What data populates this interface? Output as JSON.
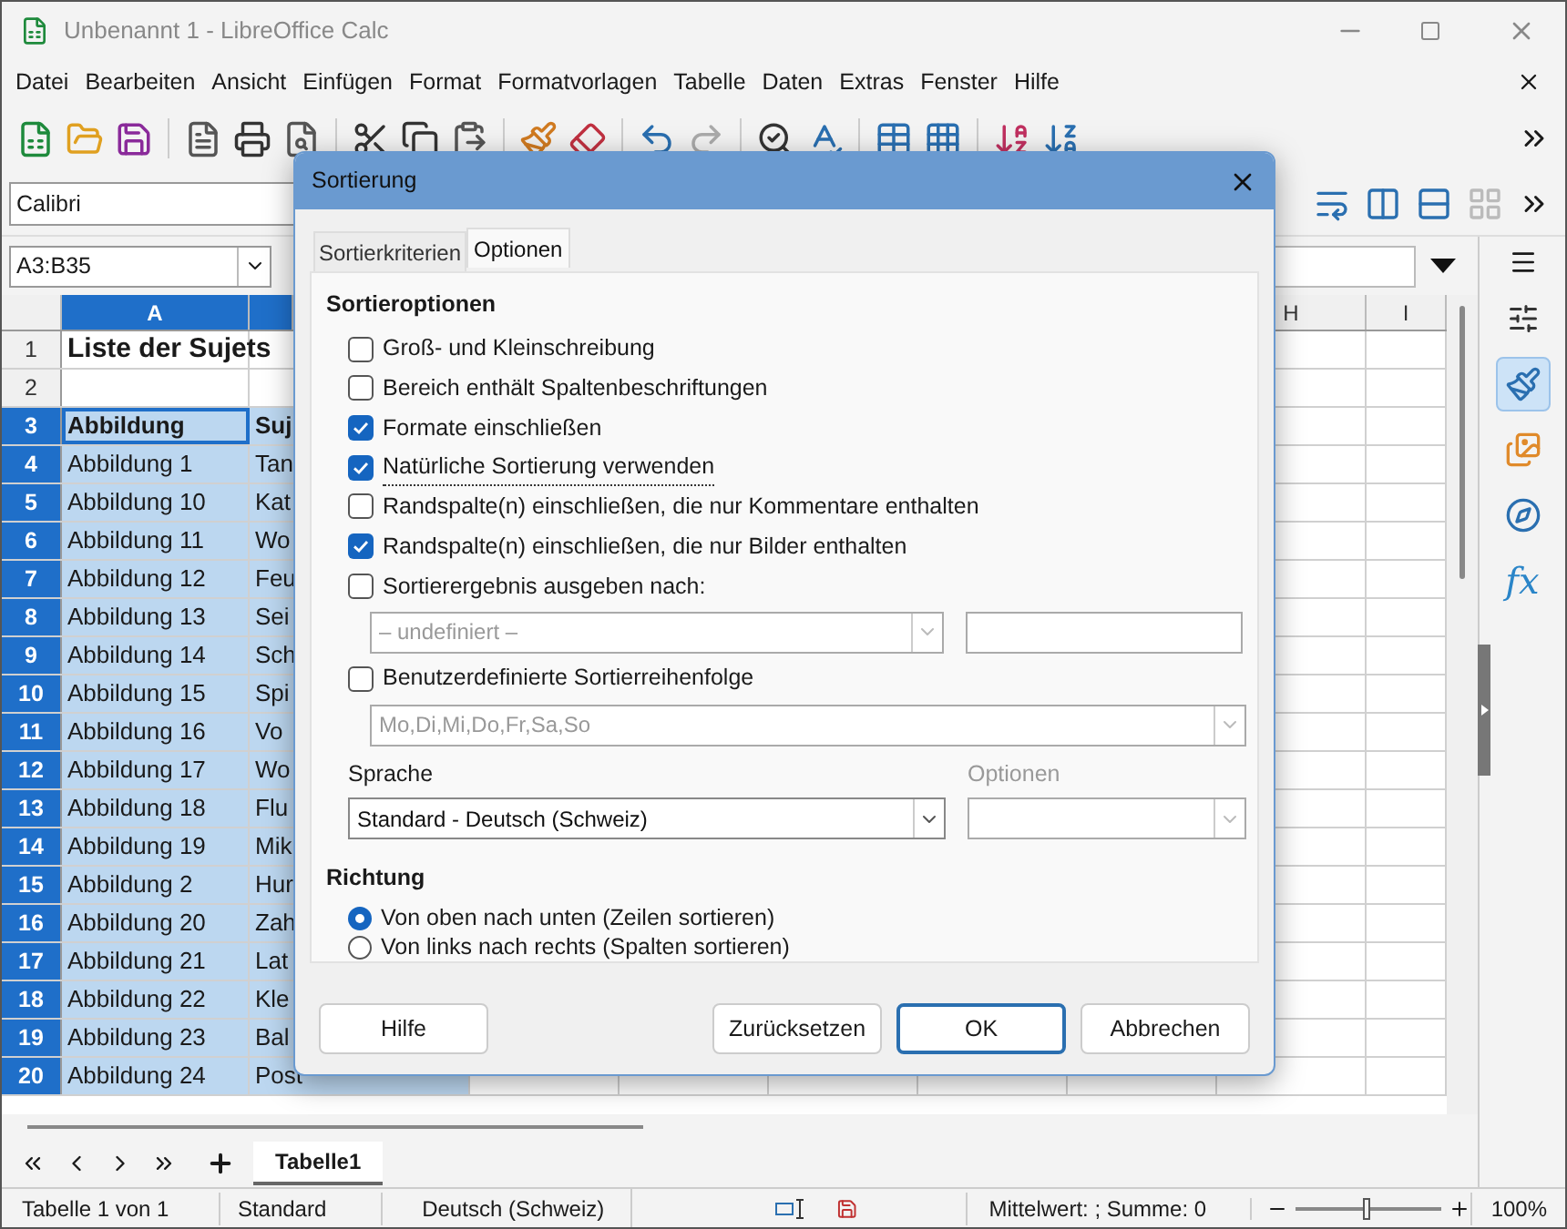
{
  "window": {
    "title": "Unbenannt 1 - LibreOffice Calc"
  },
  "menu": [
    "Datei",
    "Bearbeiten",
    "Ansicht",
    "Einfügen",
    "Format",
    "Formatvorlagen",
    "Tabelle",
    "Daten",
    "Extras",
    "Fenster",
    "Hilfe"
  ],
  "font_name": {
    "value": "Calibri"
  },
  "name_box": {
    "value": "A3:B35"
  },
  "columns": [
    {
      "label": "A",
      "selected": true
    },
    {
      "selected": true
    },
    {
      "label": "H",
      "selected": false
    },
    {
      "label": "I",
      "selected": false
    }
  ],
  "rows": [
    {
      "number": "1",
      "selected": false,
      "kind": "title",
      "a": "Liste der Sujets"
    },
    {
      "number": "2",
      "selected": false,
      "kind": "data"
    },
    {
      "number": "3",
      "selected": true,
      "kind": "header",
      "a": "Abbildung",
      "b": "Suj"
    },
    {
      "number": "4",
      "selected": true,
      "kind": "data",
      "a": "Abbildung 1",
      "b": "Tan"
    },
    {
      "number": "5",
      "selected": true,
      "kind": "data",
      "a": "Abbildung 10",
      "b": "Kat"
    },
    {
      "number": "6",
      "selected": true,
      "kind": "data",
      "a": "Abbildung 11",
      "b": "Wo"
    },
    {
      "number": "7",
      "selected": true,
      "kind": "data",
      "a": "Abbildung 12",
      "b": "Feu"
    },
    {
      "number": "8",
      "selected": true,
      "kind": "data",
      "a": "Abbildung 13",
      "b": "Sei"
    },
    {
      "number": "9",
      "selected": true,
      "kind": "data",
      "a": "Abbildung 14",
      "b": "Sch"
    },
    {
      "number": "10",
      "selected": true,
      "kind": "data",
      "a": "Abbildung 15",
      "b": "Spi"
    },
    {
      "number": "11",
      "selected": true,
      "kind": "data",
      "a": "Abbildung 16",
      "b": "Vo"
    },
    {
      "number": "12",
      "selected": true,
      "kind": "data",
      "a": "Abbildung 17",
      "b": "Wo"
    },
    {
      "number": "13",
      "selected": true,
      "kind": "data",
      "a": "Abbildung 18",
      "b": "Flu"
    },
    {
      "number": "14",
      "selected": true,
      "kind": "data",
      "a": "Abbildung 19",
      "b": "Mik"
    },
    {
      "number": "15",
      "selected": true,
      "kind": "data",
      "a": "Abbildung 2",
      "b": "Hur"
    },
    {
      "number": "16",
      "selected": true,
      "kind": "data",
      "a": "Abbildung 20",
      "b": "Zah"
    },
    {
      "number": "17",
      "selected": true,
      "kind": "data",
      "a": "Abbildung 21",
      "b": "Lat"
    },
    {
      "number": "18",
      "selected": true,
      "kind": "data",
      "a": "Abbildung 22",
      "b": "Kle"
    },
    {
      "number": "19",
      "selected": true,
      "kind": "data",
      "a": "Abbildung 23",
      "b": "Bal"
    },
    {
      "number": "20",
      "selected": true,
      "kind": "data",
      "a": "Abbildung 24",
      "b": "Post"
    }
  ],
  "sidebar": [
    {
      "kind": "properties",
      "selected": false
    },
    {
      "kind": "styles",
      "selected": true
    },
    {
      "kind": "gallery",
      "selected": false
    },
    {
      "kind": "navigator",
      "selected": false
    },
    {
      "kind": "functions",
      "selected": false,
      "label": "fx"
    }
  ],
  "sheet_tabs": [
    {
      "label": "Tabelle1",
      "selected": true
    }
  ],
  "status_bar": {
    "sheet": "Tabelle 1 von 1",
    "page_style": "Standard",
    "language": "Deutsch (Schweiz)",
    "summary": "Mittelwert: ; Summe: 0",
    "zoom": {
      "level": 0.48
    },
    "zoom_reading": "100%"
  },
  "dialog": {
    "title": "Sortierung",
    "tabs": [
      {
        "label": "Sortierkriterien",
        "selected": false
      },
      {
        "label": "Optionen",
        "selected": true
      }
    ],
    "section_title": "Sortieroptionen",
    "options": [
      {
        "label": "Groß- und Kleinschreibung",
        "checked": false,
        "focused": false
      },
      {
        "label": "Bereich enthält Spaltenbeschriftungen",
        "checked": false,
        "focused": false
      },
      {
        "label": "Formate einschließen",
        "checked": true,
        "focused": false
      },
      {
        "label": "Natürliche Sortierung verwenden",
        "checked": true,
        "focused": true
      },
      {
        "label": "Randspalte(n) einschließen, die nur Kommentare enthalten",
        "checked": false,
        "focused": false
      },
      {
        "label": "Randspalte(n) einschließen, die nur Bilder enthalten",
        "checked": true,
        "focused": false
      },
      {
        "label": "Sortierergebnis ausgeben nach:",
        "checked": false,
        "focused": false
      }
    ],
    "output_target": {
      "value": "– undefiniert –",
      "disabled": true
    },
    "custom_order": {
      "label": "Benutzerdefinierte Sortierreihenfolge",
      "checked": false,
      "value": "Mo,Di,Mi,Do,Fr,Sa,So",
      "disabled": true
    },
    "language_label": "Sprache",
    "language": {
      "value": "Standard - Deutsch (Schweiz)"
    },
    "algorithm_label": {
      "text": "Optionen",
      "disabled": true
    },
    "direction_title": "Richtung",
    "directions": [
      {
        "label": "Von oben nach unten (Zeilen sortieren)",
        "selected": true
      },
      {
        "label": "Von links nach rechts (Spalten sortieren)",
        "selected": false
      }
    ],
    "buttons": [
      {
        "label": "Hilfe",
        "kind": "help",
        "default": false
      },
      {
        "label": "Zurücksetzen",
        "kind": "action",
        "default": false
      },
      {
        "label": "OK",
        "kind": "action",
        "default": true
      },
      {
        "label": "Abbrechen",
        "kind": "action",
        "default": false
      }
    ]
  }
}
